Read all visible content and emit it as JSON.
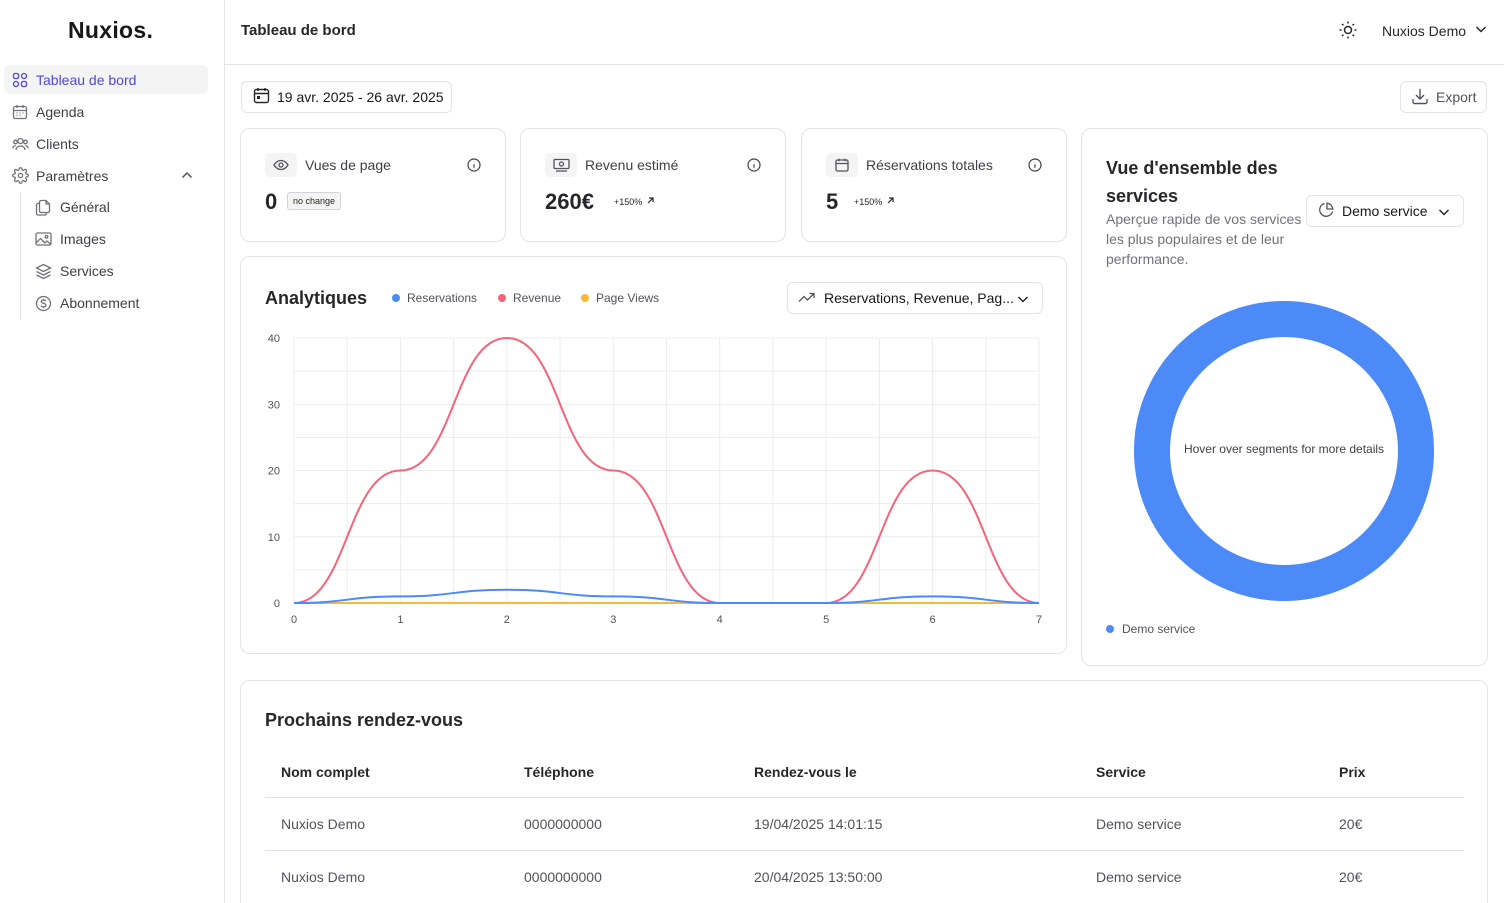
{
  "app": {
    "logo": "Nuxios."
  },
  "sidebar": {
    "items": [
      {
        "label": "Tableau de bord",
        "icon": "dashboard-grid-icon",
        "active": true
      },
      {
        "label": "Agenda",
        "icon": "calendar-icon"
      },
      {
        "label": "Clients",
        "icon": "users-icon"
      },
      {
        "label": "Paramètres",
        "icon": "gear-icon",
        "expanded": true
      }
    ],
    "subitems": [
      {
        "label": "Général",
        "icon": "files-icon"
      },
      {
        "label": "Images",
        "icon": "image-icon"
      },
      {
        "label": "Services",
        "icon": "layers-icon"
      },
      {
        "label": "Abonnement",
        "icon": "dollar-circle-icon"
      }
    ]
  },
  "header": {
    "title": "Tableau de bord",
    "user": "Nuxios Demo"
  },
  "toolbar": {
    "date_range": "19 avr. 2025 - 26 avr. 2025",
    "export_label": "Export"
  },
  "stats": [
    {
      "label": "Vues de page",
      "value": "0",
      "badge": "no change",
      "icon": "eye-icon"
    },
    {
      "label": "Revenu estimé",
      "value": "260€",
      "change": "+150%",
      "icon": "banknote-icon"
    },
    {
      "label": "Réservations totales",
      "value": "5",
      "change": "+150%",
      "icon": "calendar-icon"
    }
  ],
  "analytics": {
    "title": "Analytiques",
    "select_label": "Reservations, Revenue, Pag..."
  },
  "chart_data": {
    "type": "line",
    "x": [
      0,
      1,
      2,
      3,
      4,
      5,
      6,
      7
    ],
    "xlim": [
      0,
      7
    ],
    "ylim": [
      0,
      40
    ],
    "yticks": [
      0,
      10,
      20,
      30,
      40
    ],
    "grid": true,
    "legend_position": "top",
    "series": [
      {
        "name": "Reservations",
        "color": "#4b8af7",
        "values": [
          0,
          1,
          2,
          1,
          0,
          0,
          1,
          0
        ]
      },
      {
        "name": "Revenue",
        "color": "#f4647a",
        "values": [
          0,
          20,
          40,
          20,
          0,
          0,
          20,
          0
        ]
      },
      {
        "name": "Page Views",
        "color": "#f6b93b",
        "values": [
          0,
          0,
          0,
          0,
          0,
          0,
          0,
          0
        ]
      }
    ]
  },
  "services": {
    "title": "Vue d'ensemble des services",
    "description": "Aperçue rapide de vos services les plus populaires et de leur performance.",
    "select_label": "Demo service",
    "center_text": "Hover over segments for more details",
    "legend": [
      {
        "name": "Demo service",
        "color": "#4b8af7",
        "value": 100
      }
    ]
  },
  "appointments": {
    "title": "Prochains rendez-vous",
    "columns": [
      "Nom complet",
      "Téléphone",
      "Rendez-vous le",
      "Service",
      "Prix"
    ],
    "rows": [
      [
        "Nuxios Demo",
        "0000000000",
        "19/04/2025 14:01:15",
        "Demo service",
        "20€"
      ],
      [
        "Nuxios Demo",
        "0000000000",
        "20/04/2025 13:50:00",
        "Demo service",
        "20€"
      ]
    ]
  }
}
